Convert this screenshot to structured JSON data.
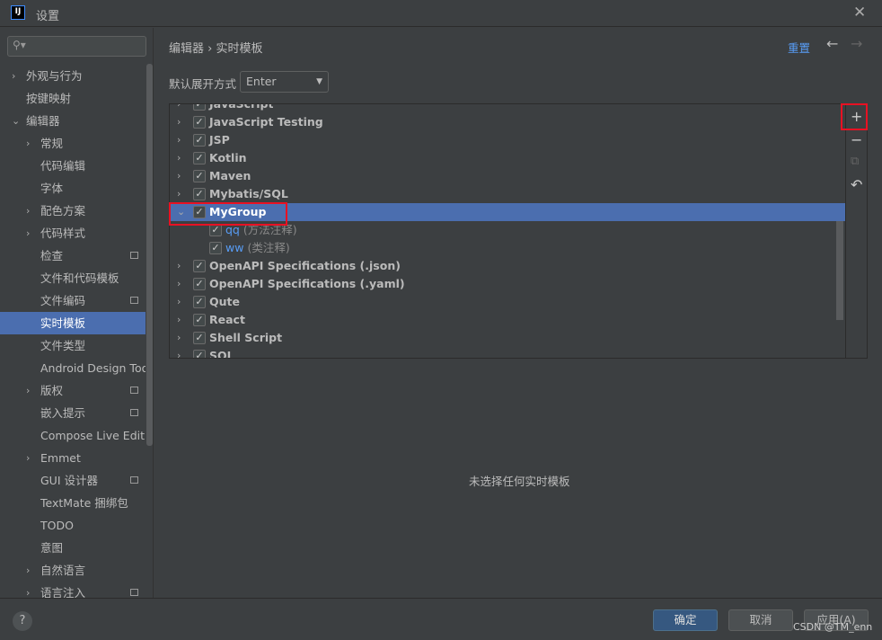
{
  "window": {
    "title": "设置",
    "logo": "IJ",
    "close": "✕"
  },
  "sidebar": {
    "search_placeholder": "",
    "items": [
      {
        "label": "外观与行为",
        "indent": 0,
        "arrow": "›"
      },
      {
        "label": "按键映射",
        "indent": 0
      },
      {
        "label": "编辑器",
        "indent": 0,
        "arrow": "⌄"
      },
      {
        "label": "常规",
        "indent": 1,
        "arrow": "›"
      },
      {
        "label": "代码编辑",
        "indent": 1
      },
      {
        "label": "字体",
        "indent": 1
      },
      {
        "label": "配色方案",
        "indent": 1,
        "arrow": "›"
      },
      {
        "label": "代码样式",
        "indent": 1,
        "arrow": "›"
      },
      {
        "label": "检查",
        "indent": 1,
        "mark": true
      },
      {
        "label": "文件和代码模板",
        "indent": 1
      },
      {
        "label": "文件编码",
        "indent": 1,
        "mark": true
      },
      {
        "label": "实时模板",
        "indent": 1,
        "selected": true
      },
      {
        "label": "文件类型",
        "indent": 1
      },
      {
        "label": "Android Design Tools",
        "indent": 1
      },
      {
        "label": "版权",
        "indent": 1,
        "arrow": "›",
        "mark": true
      },
      {
        "label": "嵌入提示",
        "indent": 1,
        "mark": true
      },
      {
        "label": "Compose Live Edit",
        "indent": 1
      },
      {
        "label": "Emmet",
        "indent": 1,
        "arrow": "›"
      },
      {
        "label": "GUI 设计器",
        "indent": 1,
        "mark": true
      },
      {
        "label": "TextMate 捆绑包",
        "indent": 1
      },
      {
        "label": "TODO",
        "indent": 1
      },
      {
        "label": "意图",
        "indent": 1
      },
      {
        "label": "自然语言",
        "indent": 1,
        "arrow": "›"
      },
      {
        "label": "语言注入",
        "indent": 1,
        "arrow": "›",
        "mark": true
      }
    ]
  },
  "main": {
    "breadcrumb": "编辑器  ›  实时模板",
    "reset": "重置",
    "back": "←",
    "forward": "→",
    "expand_label": "默认展开方式",
    "expand_value": "Enter",
    "tree": [
      {
        "label": "JavaScript"
      },
      {
        "label": "JavaScript Testing"
      },
      {
        "label": "JSP"
      },
      {
        "label": "Kotlin"
      },
      {
        "label": "Maven"
      },
      {
        "label": "Mybatis/SQL"
      },
      {
        "label": "MyGroup",
        "expanded": true,
        "selected": true
      },
      {
        "label": "qq",
        "desc": "(方法注释)",
        "child": true
      },
      {
        "label": "ww",
        "desc": "(类注释)",
        "child": true
      },
      {
        "label": "OpenAPI Specifications (.json)"
      },
      {
        "label": "OpenAPI Specifications (.yaml)"
      },
      {
        "label": "Qute"
      },
      {
        "label": "React"
      },
      {
        "label": "Shell Script"
      },
      {
        "label": "SQL"
      }
    ],
    "tools": {
      "add": "+",
      "remove": "−",
      "copy": "⧉",
      "restore": "↶"
    },
    "empty_message": "未选择任何实时模板"
  },
  "footer": {
    "help": "?",
    "ok": "确定",
    "cancel": "取消",
    "apply": "应用(A)",
    "watermark": "CSDN @TM_enn"
  },
  "colors": {
    "accent": "#4b6eaf",
    "link": "#589df6",
    "highlight": "#e81123"
  }
}
